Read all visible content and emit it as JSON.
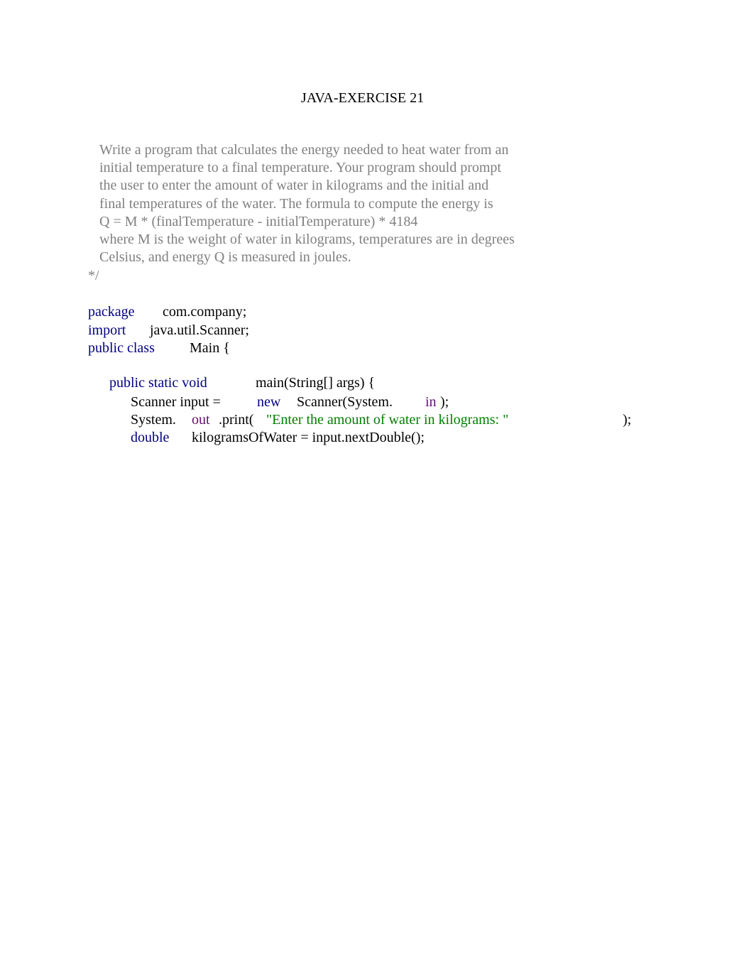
{
  "document": {
    "title": "JAVA-EXERCISE 21",
    "comment_lines": [
      "Write a program that calculates the energy needed to heat water from an",
      "initial temperature to a final temperature. Your program should prompt",
      "the user to enter the amount of water in kilograms and the initial and",
      "final temperatures of the water. The formula to compute the energy is",
      "Q = M * (finalTemperature - initialTemperature) * 4184",
      "where M is the weight of water in kilograms, temperatures are in degrees",
      "Celsius, and energy Q is measured in joules."
    ],
    "comment_end": "*/",
    "code": {
      "package_kw": "package",
      "package_name": "com.company;",
      "import_kw": "import",
      "import_name": "java.util.Scanner;",
      "class_kw": "public class",
      "class_name": "Main {",
      "method_kw": "public static void",
      "method_sig": "main(String[] args) {",
      "scanner_decl": "Scanner input =",
      "new_kw": "new",
      "scanner_ctor": "Scanner(System.",
      "in_field": "in",
      "scanner_end": ");",
      "system": "System.",
      "out_field": "out",
      "print_call": ".print(",
      "print_string": "\"Enter the amount of water in kilograms: \"",
      "print_end": ");",
      "double_kw": "double",
      "double_stmt": "kilogramsOfWater = input.nextDouble();"
    }
  },
  "colors": {
    "keyword": "#000080",
    "field": "#660e7a",
    "string": "#008000",
    "comment": "#808080"
  }
}
